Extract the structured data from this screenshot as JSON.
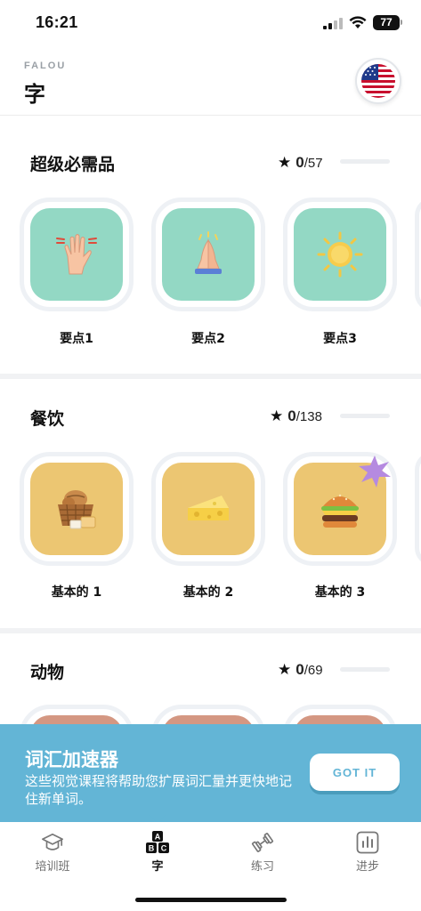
{
  "status_bar": {
    "time": "16:21",
    "battery": "77"
  },
  "header": {
    "brand": "FALOU",
    "title": "字",
    "flag_icon": "us-flag-icon"
  },
  "sections": [
    {
      "title": "超级必需品",
      "stars": "0",
      "total": "/57",
      "progress": 0,
      "cards": [
        {
          "label": "要点1",
          "icon": "raised-hand-icon",
          "bg": "#93d8c4"
        },
        {
          "label": "要点2",
          "icon": "praying-hands-icon",
          "bg": "#93d8c4"
        },
        {
          "label": "要点3",
          "icon": "sun-icon",
          "bg": "#93d8c4"
        }
      ]
    },
    {
      "title": "餐饮",
      "stars": "0",
      "total": "/138",
      "progress": 0,
      "cards": [
        {
          "label": "基本的 1",
          "icon": "bread-basket-icon",
          "bg": "#ecc672"
        },
        {
          "label": "基本的 2",
          "icon": "cheese-icon",
          "bg": "#ecc672"
        },
        {
          "label": "基本的 3",
          "icon": "burger-icon",
          "bg": "#ecc672",
          "badge": "new-sparkle-icon"
        }
      ]
    },
    {
      "title": "动物",
      "stars": "0",
      "total": "/69",
      "progress": 0,
      "cards": [
        {
          "bg": "#d49782"
        },
        {
          "bg": "#d49782"
        },
        {
          "bg": "#d49782"
        }
      ]
    }
  ],
  "banner": {
    "title": "词汇加速器",
    "body": "这些视觉课程将帮助您扩展词汇量并更快地记住新单词。",
    "button": "GOT IT"
  },
  "tabs": [
    {
      "label": "培训班",
      "icon": "graduation-cap-icon",
      "active": false
    },
    {
      "label": "字",
      "icon": "abc-blocks-icon",
      "active": true
    },
    {
      "label": "练习",
      "icon": "dumbbell-icon",
      "active": false
    },
    {
      "label": "进步",
      "icon": "bar-chart-icon",
      "active": false
    }
  ]
}
